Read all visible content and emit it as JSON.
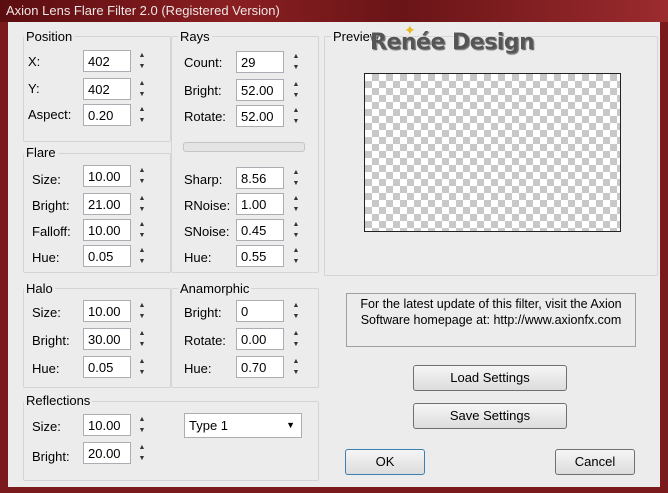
{
  "window": {
    "title": "Axion Lens Flare Filter 2.0 (Registered Version)"
  },
  "watermark": {
    "text": "Renée Design"
  },
  "position": {
    "title": "Position",
    "x_label": "X:",
    "x_value": "402",
    "y_label": "Y:",
    "y_value": "402",
    "aspect_label": "Aspect:",
    "aspect_value": "0.20"
  },
  "rays": {
    "title": "Rays",
    "count_label": "Count:",
    "count_value": "29",
    "bright_label": "Bright:",
    "bright_value": "52.00",
    "rotate_label": "Rotate:",
    "rotate_value": "52.00",
    "sharp_label": "Sharp:",
    "sharp_value": "8.56",
    "rnoise_label": "RNoise:",
    "rnoise_value": "1.00",
    "snoise_label": "SNoise:",
    "snoise_value": "0.45",
    "hue_label": "Hue:",
    "hue_value": "0.55"
  },
  "flare": {
    "title": "Flare",
    "size_label": "Size:",
    "size_value": "10.00",
    "bright_label": "Bright:",
    "bright_value": "21.00",
    "falloff_label": "Falloff:",
    "falloff_value": "10.00",
    "hue_label": "Hue:",
    "hue_value": "0.05"
  },
  "halo": {
    "title": "Halo",
    "size_label": "Size:",
    "size_value": "10.00",
    "bright_label": "Bright:",
    "bright_value": "30.00",
    "hue_label": "Hue:",
    "hue_value": "0.05"
  },
  "anamorphic": {
    "title": "Anamorphic",
    "bright_label": "Bright:",
    "bright_value": "0",
    "rotate_label": "Rotate:",
    "rotate_value": "0.00",
    "hue_label": "Hue:",
    "hue_value": "0.70"
  },
  "reflections": {
    "title": "Reflections",
    "size_label": "Size:",
    "size_value": "10.00",
    "bright_label": "Bright:",
    "bright_value": "20.00",
    "type_value": "Type 1"
  },
  "preview": {
    "title": "Preview"
  },
  "info": {
    "line1": "For the latest update of this filter, visit the Axion",
    "line2": "Software homepage at: http://www.axionfx.com"
  },
  "buttons": {
    "load": "Load Settings",
    "save": "Save Settings",
    "ok": "OK",
    "cancel": "Cancel"
  },
  "icons": {
    "spin_up": "▲",
    "spin_down": "▼",
    "dropdown": "▼",
    "logo_mark": "✦"
  }
}
